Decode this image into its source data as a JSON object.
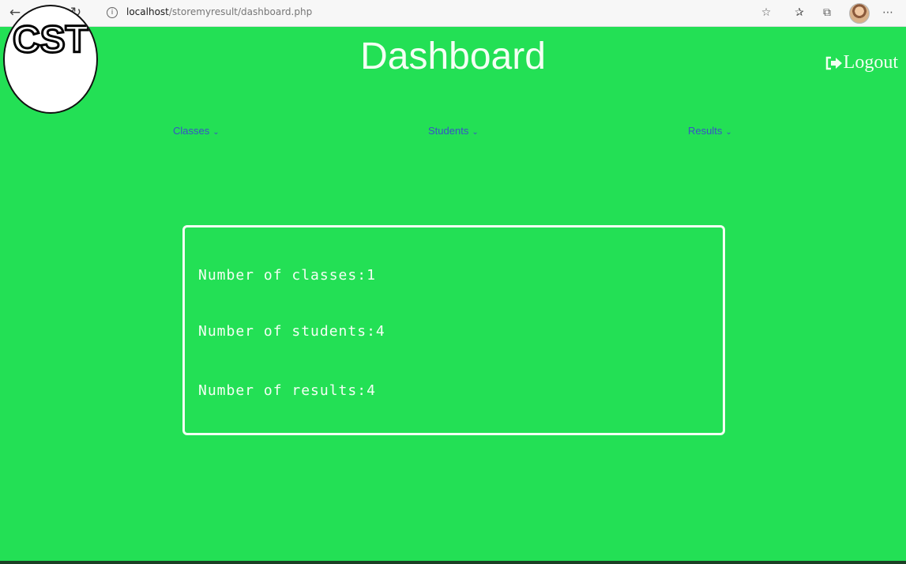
{
  "browser": {
    "url_host": "localhost",
    "url_path": "/storemyresult/dashboard.php"
  },
  "logo": {
    "text": "CST"
  },
  "header": {
    "title": "Dashboard",
    "logout_label": "Logout"
  },
  "nav": {
    "items": [
      {
        "label": "Classes"
      },
      {
        "label": "Students"
      },
      {
        "label": "Results"
      }
    ],
    "link_color": "#3a50c8"
  },
  "stats": {
    "classes": "Number of classes:1",
    "students": "Number of students:4",
    "results": "Number of results:4"
  },
  "colors": {
    "background": "#23e055",
    "foreground": "#f4fff4"
  }
}
